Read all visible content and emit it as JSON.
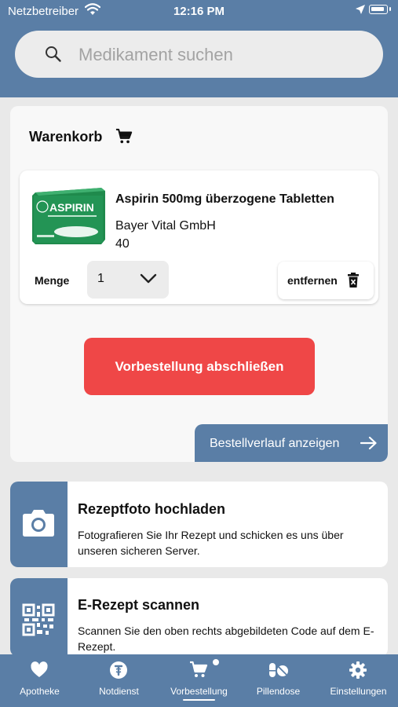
{
  "status_bar": {
    "carrier": "Netzbetreiber",
    "time": "12:16 PM"
  },
  "search": {
    "placeholder": "Medikament suchen"
  },
  "cart": {
    "title": "Warenkorb",
    "item": {
      "name": "Aspirin 500mg überzogene Tabletten",
      "manufacturer": "Bayer Vital GmbH",
      "pack_size": "40",
      "image_brand": "ASPIRIN",
      "quantity_label": "Menge",
      "quantity_value": "1",
      "remove_label": "entfernen"
    },
    "submit_label": "Vorbestellung abschließen",
    "history_label": "Bestellverlauf anzeigen"
  },
  "tiles": [
    {
      "title": "Rezeptfoto hochladen",
      "description": "Fotografieren Sie Ihr Rezept und schicken es uns über unseren sicheren Server.",
      "icon": "camera-icon"
    },
    {
      "title": "E-Rezept scannen",
      "description": "Scannen Sie den oben rechts abgebildeten Code auf dem E-Rezept.",
      "icon": "qr-code-icon"
    }
  ],
  "tabs": [
    {
      "label": "Apotheke",
      "icon": "heart-icon"
    },
    {
      "label": "Notdienst",
      "icon": "emergency-icon"
    },
    {
      "label": "Vorbestellung",
      "icon": "cart-icon",
      "active": true
    },
    {
      "label": "Pillendose",
      "icon": "pills-icon"
    },
    {
      "label": "Einstellungen",
      "icon": "gear-icon"
    }
  ],
  "colors": {
    "primary": "#5a7ea6",
    "accent": "#ef4747",
    "background": "#e9e9e9"
  }
}
